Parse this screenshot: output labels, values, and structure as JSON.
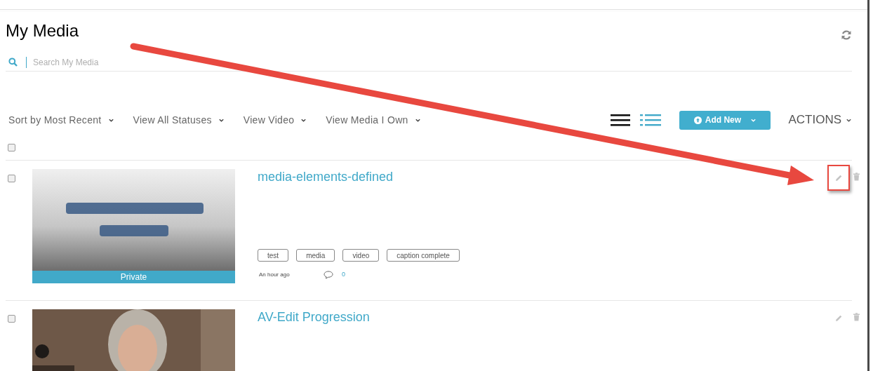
{
  "page": {
    "title": "My Media"
  },
  "search": {
    "placeholder": "Search My Media"
  },
  "filters": [
    {
      "label": "Sort by Most Recent"
    },
    {
      "label": "View All Statuses"
    },
    {
      "label": "View Video"
    },
    {
      "label": "View Media I Own"
    }
  ],
  "view_modes": [
    {
      "kind": "compact",
      "selected": false
    },
    {
      "kind": "detailed",
      "selected": true
    }
  ],
  "add_button": {
    "label": "Add New"
  },
  "actions": {
    "label": "ACTIONS"
  },
  "select_all": {
    "checked": false
  },
  "media": [
    {
      "title": "media-elements-defined",
      "checked": false,
      "status": "Private",
      "tags": [
        "test",
        "media",
        "video",
        "caption complete"
      ],
      "time": "An hour ago",
      "comments": "0",
      "edit_highlighted": true
    },
    {
      "title": "AV-Edit Progression",
      "checked": false,
      "edit_highlighted": false
    }
  ]
}
